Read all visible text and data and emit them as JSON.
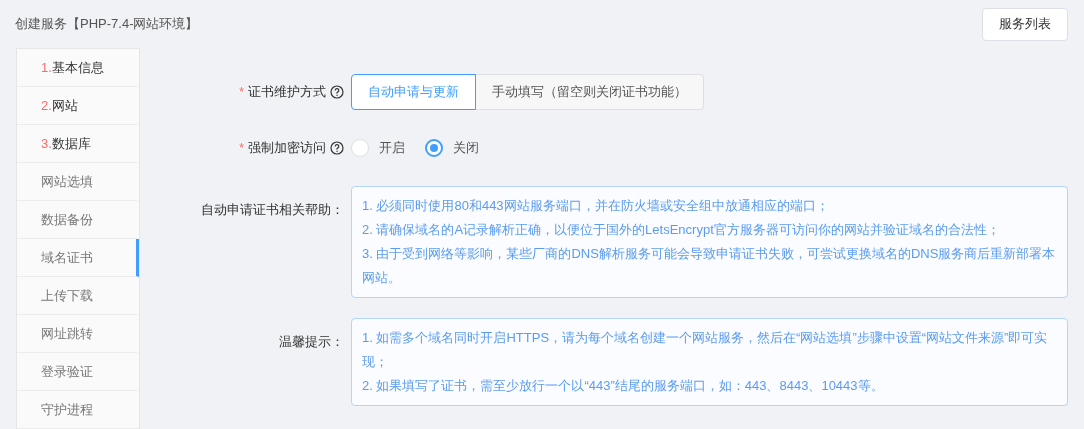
{
  "header": {
    "title": "创建服务【PHP-7.4-网站环境】",
    "button": "服务列表"
  },
  "sidebar": {
    "items": [
      {
        "prefix": "1.",
        "label": "基本信息",
        "selected": false
      },
      {
        "prefix": "2.",
        "label": "网站",
        "selected": false
      },
      {
        "prefix": "3.",
        "label": "数据库",
        "selected": false
      },
      {
        "label": "网站选填",
        "selected": false
      },
      {
        "label": "数据备份",
        "selected": false
      },
      {
        "label": "域名证书",
        "selected": true
      },
      {
        "label": "上传下载",
        "selected": false
      },
      {
        "label": "网址跳转",
        "selected": false
      },
      {
        "label": "登录验证",
        "selected": false
      },
      {
        "label": "守护进程",
        "selected": false
      }
    ]
  },
  "form": [
    {
      "kind": "segmented",
      "label": "证书维护方式",
      "required_mark": "*",
      "help_icon": true,
      "options": [
        {
          "label": "自动申请与更新",
          "selected": true
        },
        {
          "label": "手动填写（留空则关闭证书功能）",
          "selected": false
        }
      ]
    },
    {
      "kind": "radio",
      "label": "强制加密访问",
      "required_mark": "*",
      "help_icon": true,
      "options": [
        {
          "label": "开启",
          "selected": false
        },
        {
          "label": "关闭",
          "selected": true
        }
      ]
    },
    {
      "kind": "note",
      "label": "自动申请证书相关帮助：",
      "lines": [
        "1. 必须同时使用80和443网站服务端口，并在防火墙或安全组中放通相应的端口；",
        "2. 请确保域名的A记录解析正确，以便位于国外的LetsEncrypt官方服务器可访问你的网站并验证域名的合法性；",
        "3. 由于受到网络等影响，某些厂商的DNS解析服务可能会导致申请证书失败，可尝试更换域名的DNS服务商后重新部署本网站。"
      ]
    },
    {
      "kind": "note",
      "label": "温馨提示：",
      "lines": [
        "1. 如需多个域名同时开启HTTPS，请为每个域名创建一个网站服务，然后在“网站选填”步骤中设置“网站文件来源”即可实现；",
        "2. 如果填写了证书，需至少放行一个以“443”结尾的服务端口，如：443、8443、10443等。"
      ]
    }
  ]
}
